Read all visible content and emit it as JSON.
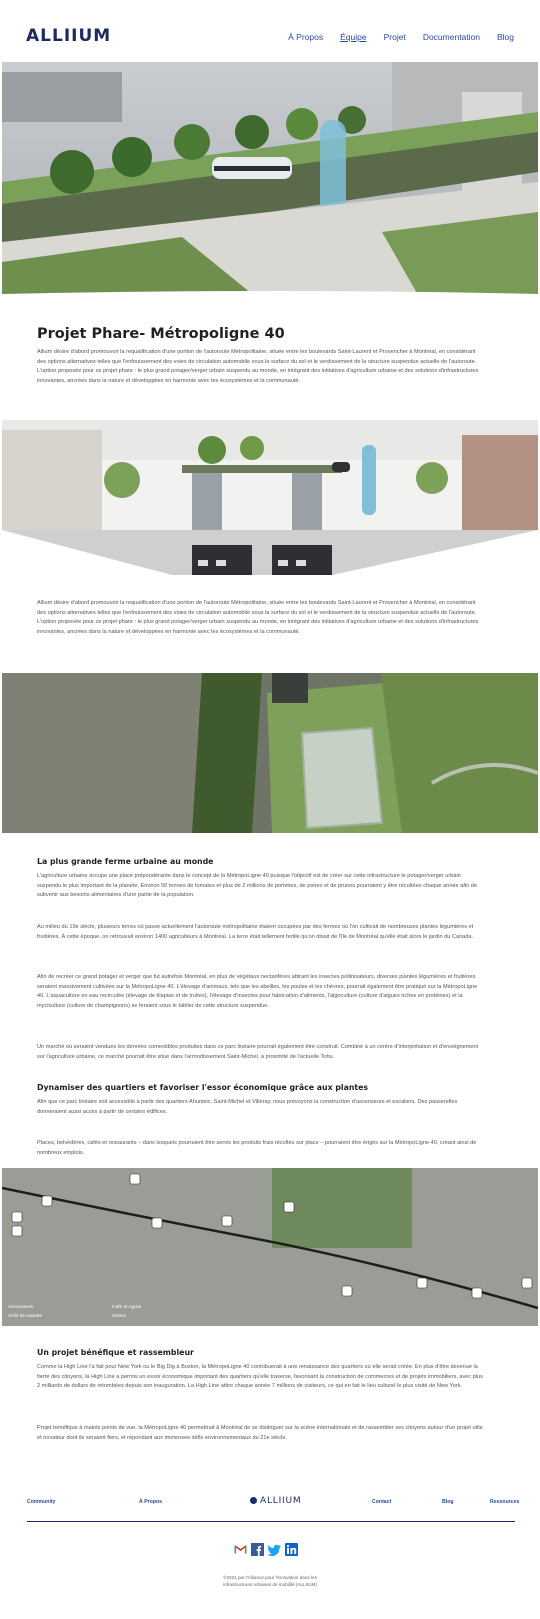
{
  "header": {
    "logo": "ALLIIUM",
    "nav": [
      "À Propos",
      "Équipe",
      "Projet",
      "Documentation",
      "Blog"
    ]
  },
  "main": {
    "title": "Projet Phare- Métropoligne 40",
    "intro": "Allium désire d'abord promouvoir la requalification d'une portion de l'autoroute Métropolitaine, située entre les boulevards Saint-Laurent et Provencher à Montréal, en considérant des options alternatives telles que l'enfouissement des voies de circulation automobile sous la surface du sol et le verdissement de la structure suspendue actuelle de l'autoroute. L'option proposée pour ce projet phare : le plus grand potager/verger urbain suspendu au monde, en intégrant des initiatives d'agriculture urbaine et des solutions d'infrastructures innovantes, ancrées dans la nature et développées en harmonie avec les écosystèmes et la communauté.",
    "intro2": "Allium désire d'abord promouvoir la requalification d'une portion de l'autoroute Métropolitaine, située entre les boulevards Saint-Laurent et Provencher à Montréal, en considérant des options alternatives telles que l'enfouissement des voies de circulation automobile sous la surface du sol et le verdissement de la structure suspendue actuelle de l'autoroute. L'option proposée pour ce projet phare : le plus grand potager/verger urbain suspendu au monde, en intégrant des initiatives d'agriculture urbaine et des solutions d'infrastructures innovantes, ancrées dans la nature et développées en harmonie avec les écosystèmes et la communauté.",
    "section1_title": "La plus grande ferme urbaine au monde",
    "section1_p1": "L'agriculture urbaine occupe une place prépondérante dans le concept de la MétropoLigne 40 puisque l'objectif est de créer sur cette infrastructure le potager/verger urbain suspendu le plus important de la planète. Environ 50 tonnes de tomates et plus de 2 millions de pommes, de poires et de prunes pourraient y être récoltées chaque année afin de subvenir aux besoins alimentaires d'une partie de la population.",
    "section1_p2": "Au milieu du 19e siècle, plusieurs terres où passe actuellement l'autoroute métropolitaine étaient occupées par des fermes où l'on cultivait de nombreuses plantes légumières et fruitières. À cette époque, on retrouvait environ 1400 agriculteurs à Montréal. La terre était tellement fertile qu'on disait de l'île de Montréal qu'elle était alors le jardin du Canada.",
    "section1_p3": "Afin de recréer ce grand potager et verger que fut autrefois Montréal, en plus de végétaux nectarifères attirant les insectes pollinisateurs, diverses plantes légumières et fruitières seraient massivement cultivées sur la MétropoLigne 40. L'élevage d'animaux, tels que les abeilles, les poules et les chèvres, pourrait également être pratiqué sur la MétropoLigne 40. L'aquaculture en eau recirculée (élevage de tilapias et de truites), l'élevage d'insectes pour fabrication d'aliments, l'algoculture (culture d'algues riches en protéines) et la myciculture (culture de champignons) se feraient sous le tablier de cette structure suspendue.",
    "section1_p4": "Un marché où seraient vendues les denrées comestibles produites dans ce parc linéaire pourrait également être construit. Combiné à un centre d'interprétation et d'enseignement sur l'agriculture urbaine, ce marché pourrait être situé dans l'arrondissement Saint-Michel, à proximité de l'actuelle Tohu.",
    "section2_title": "Dynamiser des quartiers et favoriser l'essor économique grâce aux plantes",
    "section2_p1": "Afin que ce parc linéaire soit accessible à partir des quartiers Ahuntsic, Saint-Michel et Villeray, nous prévoyons la construction d'ascenseurs et escaliers. Des passerelles donneraient aussi accès à partir de certains édifices.",
    "section2_p2": "Places, belvédères, cafés et restaurants – dans lesquels pourraient être servis les produits frais récoltés sur place – pourraient être érigés sur la MétropoLigne 40, créant ainsi de nombreux emplois.",
    "map_legend": [
      "Ascenseurs",
      "Café et Agora",
      "Arrêt de navette",
      "Serres"
    ],
    "section3_title": "Un projet bénéfique et rassembleur",
    "section3_p1": "Comme la High Line l'a fait pour New York ou le Big Dig à Boston, la MétropoLigne 40 contribuerait à une renaissance des quartiers où elle serait créée. En plus d'être devenue la fierté des citoyens, la High Line a permis un essor économique important des quartiers qu'elle traverse, favorisant la construction de commerces et de projets immobiliers, avec plus 2 milliards de dollars de retombées depuis son inauguration. La High Line attire chaque année 7 millions de visiteurs, ce qui en fait le lieu culturel le plus visité de New York.",
    "section3_p2": "Projet bénéfique à maints points de vue, la MétropoLigne 40 permettrait à Montréal de se distinguer sur la scène internationale et de rassembler ses citoyens autour d'un projet utile et novateur dont ils seraient fiers, et répondant aux immenses défis environnementaux du 21e siècle."
  },
  "footer": {
    "links": [
      "Community",
      "À Propos",
      "Contact",
      "Blog",
      "Ressources"
    ],
    "logo": "ALLIIUM",
    "social": [
      "gmail-icon",
      "facebook-icon",
      "twitter-icon",
      "linkedin-icon"
    ],
    "copyright": "©2021 par l'Alliance pour l'innovation dans les infrastructures urbaines de mobilité (ALLIIUM)"
  }
}
